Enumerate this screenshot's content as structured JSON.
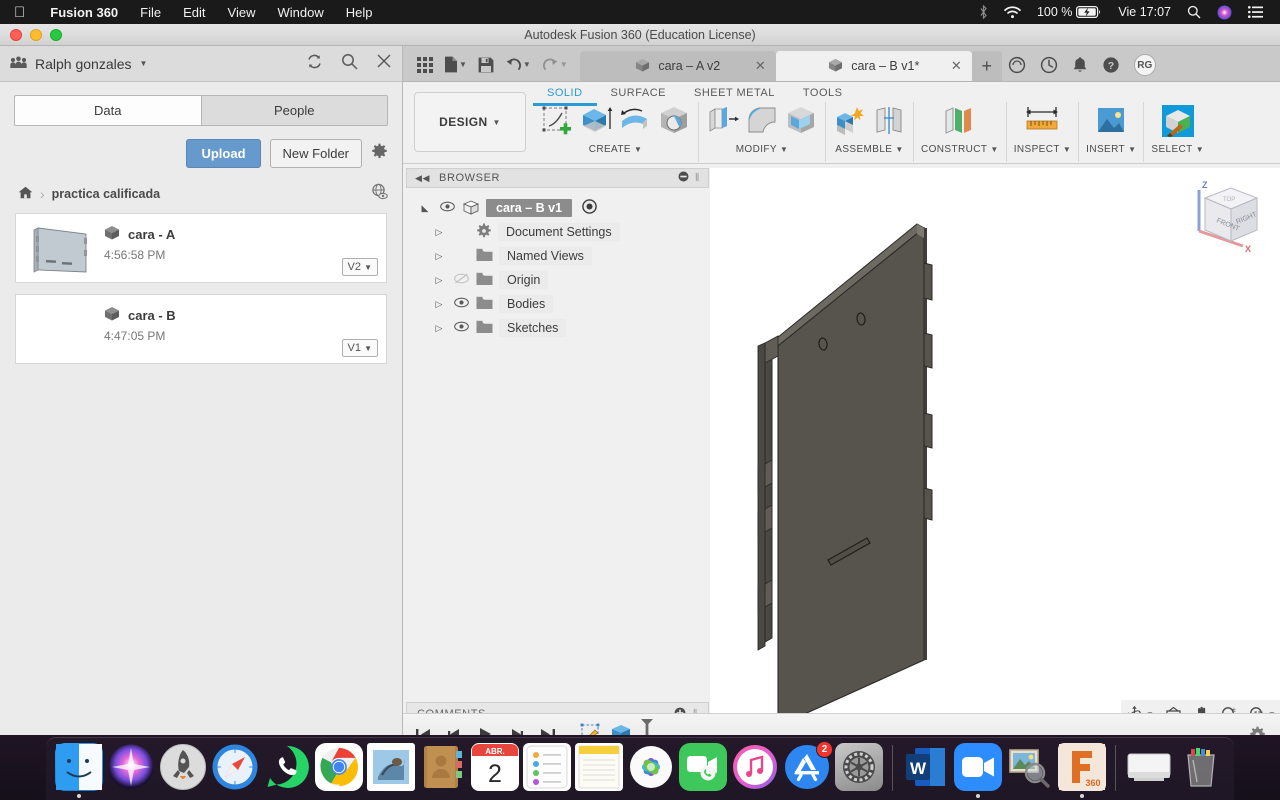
{
  "menubar": {
    "apple_icon": "apple-logo-icon",
    "items": [
      {
        "label": "Fusion 360",
        "bold": true
      },
      {
        "label": "File",
        "bold": false
      },
      {
        "label": "Edit",
        "bold": false
      },
      {
        "label": "View",
        "bold": false
      },
      {
        "label": "Window",
        "bold": false
      },
      {
        "label": "Help",
        "bold": false
      }
    ],
    "status": {
      "bluetooth_icon": "bluetooth-icon",
      "wifi_icon": "wifi-icon",
      "battery_percent": "100 %",
      "battery_icon": "battery-charging-icon",
      "clock": "Vie 17:07",
      "search_icon": "spotlight-search-icon",
      "siri_icon": "siri-icon",
      "controlcenter_icon": "notification-center-icon"
    }
  },
  "window": {
    "title": "Autodesk Fusion 360 (Education License)"
  },
  "data_panel": {
    "user_name": "Ralph gonzales",
    "user_icon": "people-group-icon",
    "chevron": "chevron-down-icon",
    "refresh_icon": "refresh-icon",
    "search_icon": "search-icon",
    "close_icon": "close-icon",
    "tabs": [
      {
        "label": "Data",
        "active": true
      },
      {
        "label": "People",
        "active": false
      }
    ],
    "upload_label": "Upload",
    "new_folder_label": "New Folder",
    "settings_icon": "gear-icon",
    "breadcrumb": {
      "home_icon": "home-icon",
      "separator": "›",
      "folder": "practica calificada",
      "globe_icon": "globe-visibility-icon"
    },
    "items": [
      {
        "name": "cara - A",
        "time": "4:56:58 PM",
        "version": "V2",
        "has_thumbnail": true,
        "type_icon": "cube-icon"
      },
      {
        "name": "cara - B",
        "time": "4:47:05 PM",
        "version": "V1",
        "has_thumbnail": false,
        "type_icon": "cube-icon"
      }
    ]
  },
  "toolbar": {
    "quick_access": [
      {
        "name": "grid-apps-icon"
      },
      {
        "name": "new-file-icon",
        "has_caret": true
      },
      {
        "name": "save-icon"
      },
      {
        "name": "undo-icon",
        "has_caret": true
      },
      {
        "name": "redo-icon",
        "has_caret": true
      }
    ],
    "doc_tabs": [
      {
        "label": "cara – A v2",
        "active": false,
        "icon": "cube-icon"
      },
      {
        "label": "cara – B v1*",
        "active": true,
        "icon": "cube-icon"
      }
    ],
    "new_tab_icon": "plus-icon",
    "trailing_icons": [
      {
        "name": "job-status-icon"
      },
      {
        "name": "recent-activity-icon"
      },
      {
        "name": "notifications-bell-icon"
      },
      {
        "name": "help-icon"
      }
    ],
    "avatar_initials": "RG"
  },
  "ribbon": {
    "workspace_label": "DESIGN",
    "workspace_caret": "caret-down-icon",
    "tabs": [
      {
        "label": "SOLID",
        "active": true
      },
      {
        "label": "SURFACE",
        "active": false
      },
      {
        "label": "SHEET METAL",
        "active": false
      },
      {
        "label": "TOOLS",
        "active": false
      }
    ],
    "groups": [
      {
        "label": "CREATE",
        "has_caret": true,
        "icons": [
          "create-sketch-icon",
          "extrude-icon",
          "revolve-icon",
          "sweep-icon"
        ]
      },
      {
        "label": "MODIFY",
        "has_caret": true,
        "icons": [
          "press-pull-icon",
          "fillet-icon",
          "shell-icon"
        ]
      },
      {
        "label": "ASSEMBLE",
        "has_caret": true,
        "icons": [
          "new-component-icon",
          "joint-icon"
        ]
      },
      {
        "label": "CONSTRUCT",
        "has_caret": true,
        "icons": [
          "offset-plane-icon"
        ]
      },
      {
        "label": "INSPECT",
        "has_caret": true,
        "icons": [
          "measure-icon"
        ]
      },
      {
        "label": "INSERT",
        "has_caret": true,
        "icons": [
          "insert-image-icon"
        ]
      },
      {
        "label": "SELECT",
        "has_caret": true,
        "icons": [
          "select-paint-icon"
        ]
      }
    ]
  },
  "browser": {
    "title": "BROWSER",
    "collapse_icon": "collapse-left-icon",
    "minimize_icon": "minimize-icon",
    "grip_icon": "resize-grip-icon",
    "tree": [
      {
        "label": "cara – B v1",
        "root": true,
        "eye": "visible",
        "icon": "component-icon",
        "badge": "active-component-icon",
        "arrow": "expanded"
      },
      {
        "label": "Document Settings",
        "root": false,
        "eye": "none",
        "icon": "gear-icon",
        "arrow": "collapsed"
      },
      {
        "label": "Named Views",
        "root": false,
        "eye": "none",
        "icon": "folder-icon",
        "arrow": "collapsed"
      },
      {
        "label": "Origin",
        "root": false,
        "eye": "hidden",
        "icon": "folder-icon",
        "arrow": "collapsed"
      },
      {
        "label": "Bodies",
        "root": false,
        "eye": "visible",
        "icon": "folder-icon",
        "arrow": "collapsed"
      },
      {
        "label": "Sketches",
        "root": false,
        "eye": "visible",
        "icon": "folder-icon",
        "arrow": "collapsed"
      }
    ]
  },
  "comments": {
    "title": "COMMENTS",
    "add_icon": "add-comment-icon",
    "grip_icon": "resize-grip-icon"
  },
  "canvas": {
    "viewcube": {
      "labels": [
        "TOP",
        "FRONT",
        "RIGHT"
      ],
      "axes": [
        {
          "label": "Z",
          "color": "#4a6fd4"
        },
        {
          "label": "X",
          "color": "#e06666"
        }
      ]
    },
    "model_color": "#55524b"
  },
  "navbar": {
    "items": [
      {
        "name": "orbit-icon",
        "has_caret": true
      },
      {
        "name": "look-at-icon",
        "has_caret": false
      },
      {
        "name": "pan-icon",
        "has_caret": false
      },
      {
        "name": "zoom-icon",
        "has_caret": false
      },
      {
        "name": "zoom-window-icon",
        "has_caret": true
      },
      {
        "name": "display-settings-icon",
        "has_caret": true
      },
      {
        "name": "grid-snaps-icon",
        "has_caret": true
      },
      {
        "name": "viewports-icon",
        "has_caret": true
      }
    ]
  },
  "timeline": {
    "buttons": [
      {
        "name": "go-to-beginning-icon"
      },
      {
        "name": "step-back-icon"
      },
      {
        "name": "play-icon"
      },
      {
        "name": "step-forward-icon"
      },
      {
        "name": "go-to-end-icon"
      }
    ],
    "features": [
      {
        "name": "sketch-feature-icon"
      },
      {
        "name": "extrude-feature-icon"
      }
    ],
    "settings_icon": "gear-icon"
  },
  "dock": {
    "items": [
      {
        "name": "finder",
        "running": true
      },
      {
        "name": "siri",
        "running": false
      },
      {
        "name": "launchpad",
        "running": false
      },
      {
        "name": "safari",
        "running": false
      },
      {
        "name": "whatsapp",
        "running": false
      },
      {
        "name": "chrome",
        "running": false
      },
      {
        "name": "mail",
        "running": false
      },
      {
        "name": "contacts",
        "running": false
      },
      {
        "name": "calendar",
        "running": false,
        "month": "ABR.",
        "day": "2"
      },
      {
        "name": "reminders",
        "running": false
      },
      {
        "name": "notes",
        "running": false
      },
      {
        "name": "photos",
        "running": false
      },
      {
        "name": "facetime",
        "running": false
      },
      {
        "name": "itunes",
        "running": false
      },
      {
        "name": "app-store",
        "running": false,
        "badge": "2"
      },
      {
        "name": "system-preferences",
        "running": false
      },
      {
        "name": "word",
        "running": false
      },
      {
        "name": "zoom",
        "running": true
      },
      {
        "name": "preview",
        "running": false
      },
      {
        "name": "fusion-360",
        "running": true,
        "label": "360"
      }
    ],
    "trash_items": [
      {
        "name": "external-drive"
      },
      {
        "name": "trash"
      }
    ]
  }
}
